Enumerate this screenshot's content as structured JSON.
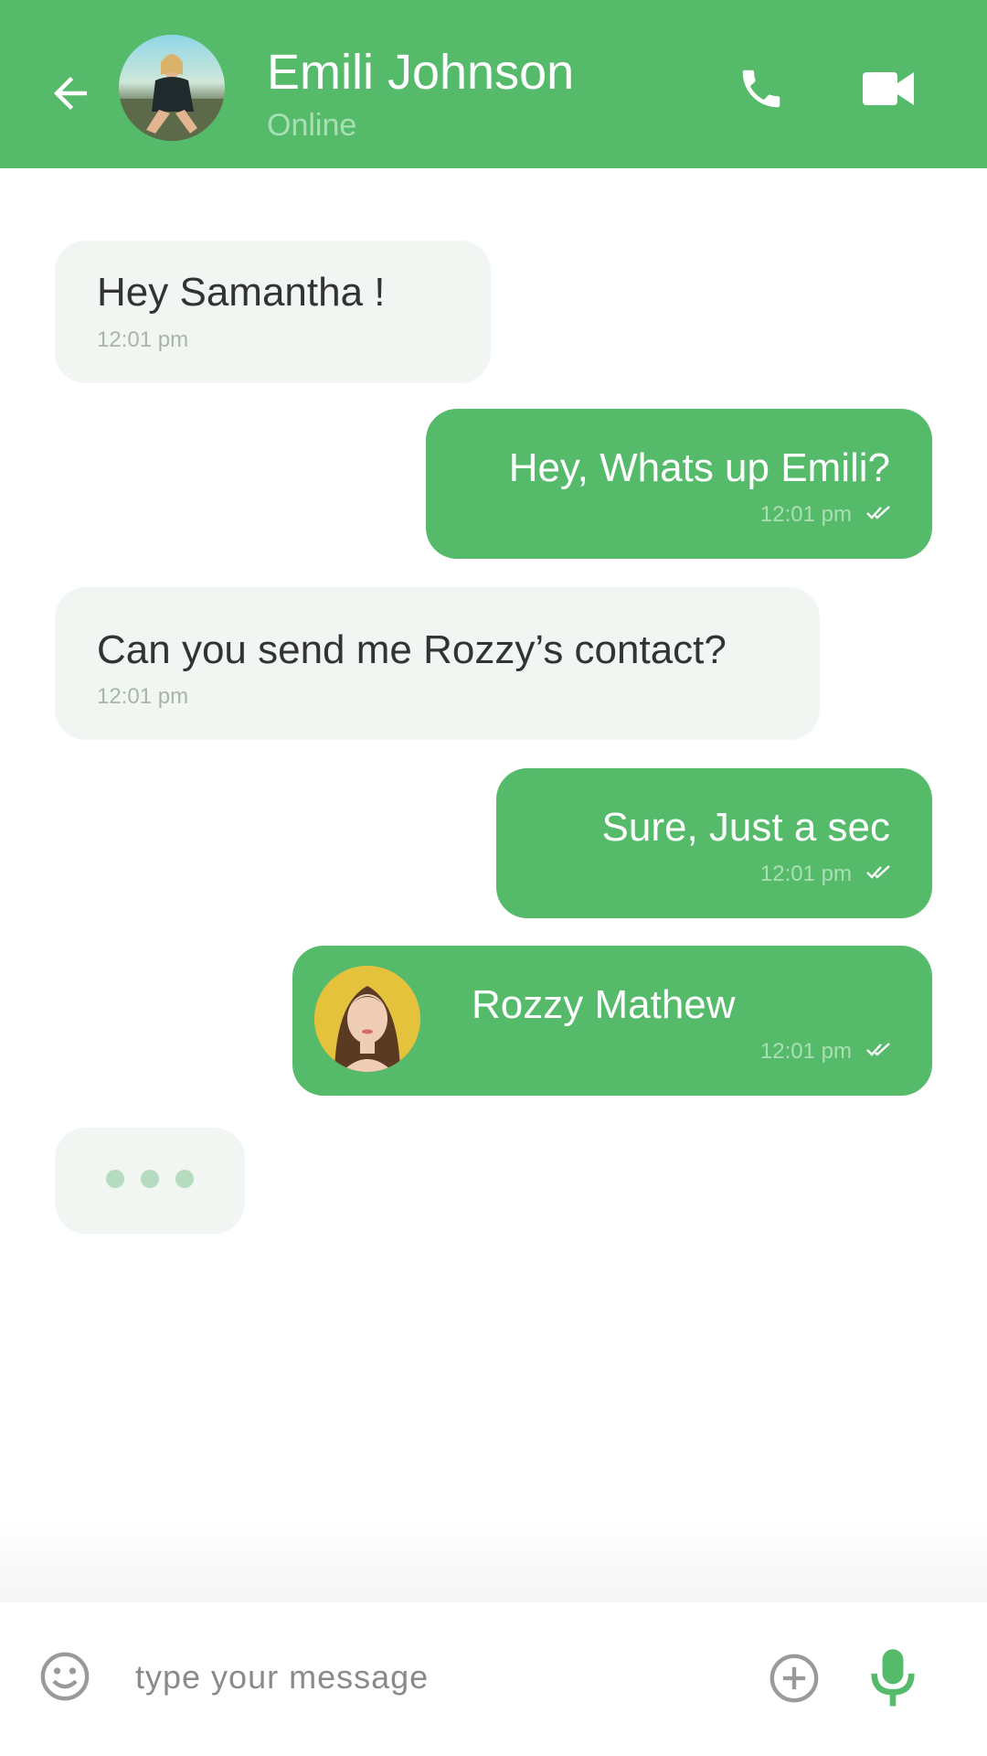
{
  "header": {
    "contact_name": "Emili Johnson",
    "status": "Online",
    "back_icon": "back-arrow-icon",
    "call_icon": "phone-icon",
    "video_icon": "video-camera-icon"
  },
  "messages": [
    {
      "direction": "incoming",
      "text": "Hey Samantha !",
      "time": "12:01 pm"
    },
    {
      "direction": "outgoing",
      "text": "Hey, Whats up Emili?",
      "time": "12:01 pm",
      "read": true
    },
    {
      "direction": "incoming",
      "text": "Can you send me Rozzy’s contact?",
      "time": "12:01 pm"
    },
    {
      "direction": "outgoing",
      "text": "Sure, Just a sec",
      "time": "12:01 pm",
      "read": true
    },
    {
      "direction": "outgoing",
      "type": "contact",
      "text": "Rozzy Mathew",
      "time": "12:01 pm",
      "read": true
    }
  ],
  "typing_indicator": true,
  "composer": {
    "placeholder": "type your message",
    "emoji_icon": "emoji-icon",
    "attach_icon": "plus-circle-icon",
    "mic_icon": "microphone-icon"
  },
  "colors": {
    "accent": "#55bb6b",
    "incoming_bubble": "#f1f6f2",
    "status_text": "#a9dfb3",
    "typing_dot": "#b6dcbf"
  }
}
